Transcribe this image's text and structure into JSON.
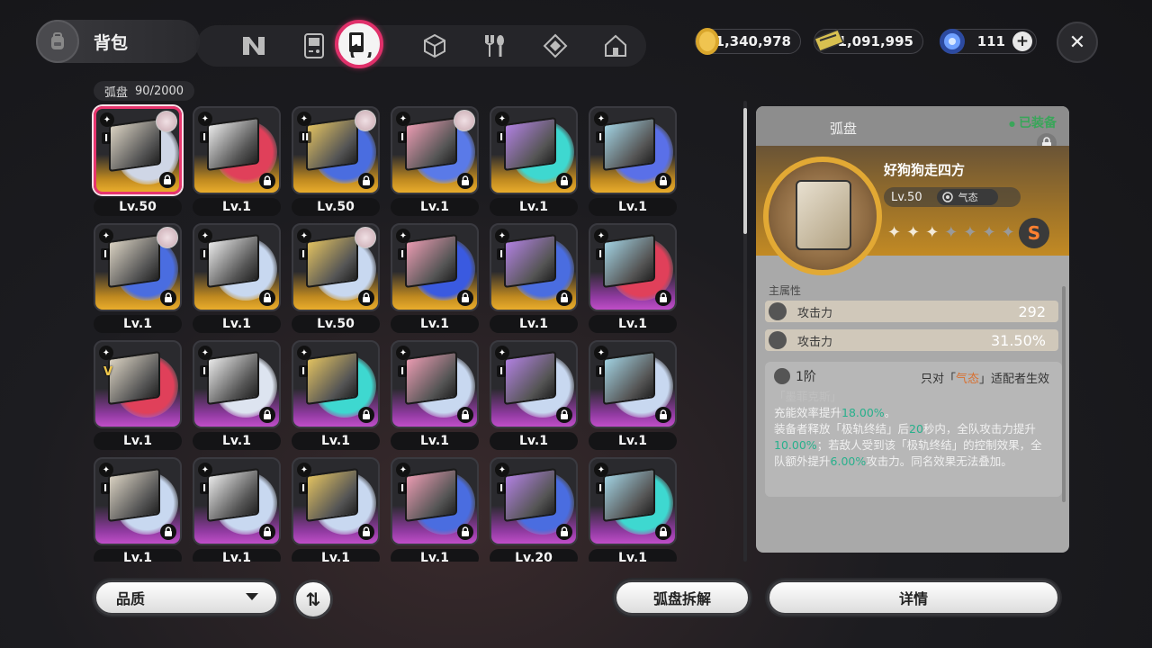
{
  "header": {
    "title": "背包",
    "tabs": [
      {
        "icon": "n-logo-icon"
      },
      {
        "icon": "gameboy-icon"
      },
      {
        "icon": "disc-case-icon",
        "active": true
      },
      {
        "icon": "cube-icon"
      },
      {
        "icon": "fork-spoon-icon"
      },
      {
        "icon": "diamond-box-icon"
      },
      {
        "icon": "home-icon"
      }
    ],
    "currencies": [
      {
        "name": "coin",
        "amount": "1,340,978",
        "color": "#e3b23c"
      },
      {
        "name": "ticket",
        "amount": "1,091,995",
        "color": "#d8c050"
      },
      {
        "name": "polychrome",
        "amount": "111",
        "color": "#4d7cf0"
      }
    ],
    "plus_label": "+",
    "close_label": "✕"
  },
  "inventory": {
    "category": "弧盘",
    "count": "90/2000",
    "items": [
      {
        "lv": "Lv.50",
        "tier": "I",
        "rank": "S",
        "selected": true,
        "avatar": true,
        "disc": "#cfd6e6"
      },
      {
        "lv": "Lv.1",
        "tier": "I",
        "rank": "S",
        "avatar": false,
        "disc": "#e0405a"
      },
      {
        "lv": "Lv.50",
        "tier": "II",
        "rank": "S",
        "avatar": true,
        "disc": "#4a6de0"
      },
      {
        "lv": "Lv.1",
        "tier": "I",
        "rank": "S",
        "avatar": true,
        "disc": "#5a7ae8"
      },
      {
        "lv": "Lv.1",
        "tier": "I",
        "rank": "S",
        "avatar": false,
        "disc": "#3ed8d0"
      },
      {
        "lv": "Lv.1",
        "tier": "I",
        "rank": "S",
        "avatar": false,
        "disc": "#5a70e8"
      },
      {
        "lv": "Lv.1",
        "tier": "I",
        "rank": "S",
        "avatar": true,
        "disc": "#4a6de0"
      },
      {
        "lv": "Lv.1",
        "tier": "I",
        "rank": "S",
        "avatar": false,
        "disc": "#c8d8f0"
      },
      {
        "lv": "Lv.50",
        "tier": "I",
        "rank": "S",
        "avatar": true,
        "disc": "#c8d8f0"
      },
      {
        "lv": "Lv.1",
        "tier": "I",
        "rank": "S",
        "avatar": false,
        "disc": "#3a5ae0"
      },
      {
        "lv": "Lv.1",
        "tier": "I",
        "rank": "S",
        "avatar": false,
        "disc": "#4a6de0"
      },
      {
        "lv": "Lv.1",
        "tier": "I",
        "rank": "A",
        "avatar": false,
        "disc": "#e0405a"
      },
      {
        "lv": "Lv.1",
        "tier": "V",
        "rank": "A",
        "equipped": true,
        "avatar": false,
        "disc": "#e0405a"
      },
      {
        "lv": "Lv.1",
        "tier": "I",
        "rank": "A",
        "avatar": false,
        "disc": "#dde4f0"
      },
      {
        "lv": "Lv.1",
        "tier": "I",
        "rank": "A",
        "avatar": false,
        "disc": "#3ed8d0"
      },
      {
        "lv": "Lv.1",
        "tier": "I",
        "rank": "A",
        "avatar": false,
        "disc": "#c8d8f0"
      },
      {
        "lv": "Lv.1",
        "tier": "I",
        "rank": "A",
        "avatar": false,
        "disc": "#c8d8f0"
      },
      {
        "lv": "Lv.1",
        "tier": "I",
        "rank": "A",
        "avatar": false,
        "disc": "#c8d8f0"
      },
      {
        "lv": "Lv.1",
        "tier": "I",
        "rank": "A",
        "avatar": false,
        "disc": "#c8d8f0"
      },
      {
        "lv": "Lv.1",
        "tier": "I",
        "rank": "A",
        "avatar": false,
        "disc": "#c8d8f0"
      },
      {
        "lv": "Lv.1",
        "tier": "I",
        "rank": "A",
        "avatar": false,
        "disc": "#c8d8f0"
      },
      {
        "lv": "Lv.1",
        "tier": "I",
        "rank": "A",
        "avatar": false,
        "disc": "#4a6de0"
      },
      {
        "lv": "Lv.20",
        "tier": "I",
        "rank": "A",
        "avatar": false,
        "disc": "#4a6de0"
      },
      {
        "lv": "Lv.1",
        "tier": "I",
        "rank": "A",
        "avatar": false,
        "disc": "#3ed8d0"
      }
    ]
  },
  "detail": {
    "type_label": "弧盘",
    "equipped_label": "已装备",
    "name": "好狗狗走四方",
    "level": "Lv.50",
    "specialty": "气态",
    "stars_on": 3,
    "stars_total": 7,
    "grade": "S",
    "main_attr_title": "主属性",
    "main_attrs": [
      {
        "name": "攻击力",
        "value": "292"
      },
      {
        "name": "攻击力",
        "value": "31.50%"
      }
    ],
    "set_tier": "1阶",
    "set_condition_pre": "只对「",
    "set_condition_hl": "气态",
    "set_condition_post": "」适配者生效",
    "set_name": "「墨菲克斯」",
    "desc_1": "充能效率提升",
    "desc_1_val": "18.00%",
    "desc_1_end": "。",
    "desc_2a": "装备者释放「极轨终结」后",
    "desc_2_sec": "20",
    "desc_2b": "秒内，全队攻击力提升",
    "desc_2_val": "10.00%",
    "desc_2c": "；若敌人受到该「极轨终结」的控制效果，全队额外提升",
    "desc_2_val2": "6.00%",
    "desc_2d": "攻击力。同名效果无法叠加。"
  },
  "bottom": {
    "quality_label": "品质",
    "sort_label": "⇅",
    "dismantle_label": "弧盘拆解",
    "details_label": "详情"
  }
}
